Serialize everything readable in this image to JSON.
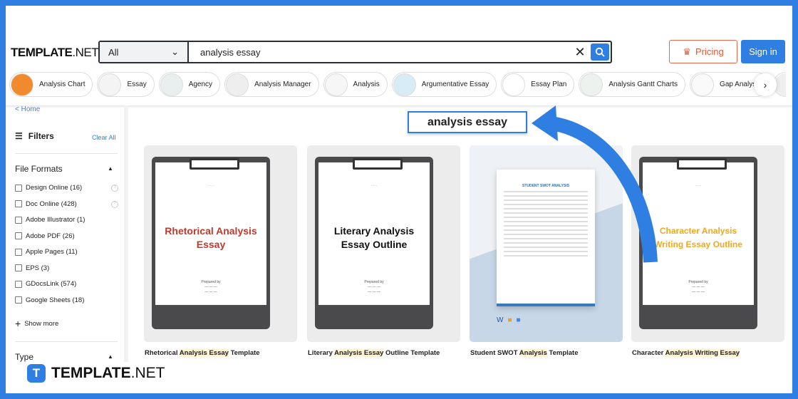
{
  "header": {
    "logo_bold": "TEMPLATE",
    "logo_light": ".NET",
    "category": "All",
    "query": "analysis essay",
    "pricing": "Pricing",
    "signin": "Sign in"
  },
  "chips": [
    "Analysis Chart",
    "Essay",
    "Agency",
    "Analysis Manager",
    "Analysis",
    "Argumentative Essay",
    "Essay Plan",
    "Analysis Gantt Charts",
    "Gap Analysis"
  ],
  "sidebar": {
    "home": "< Home",
    "filters": "Filters",
    "clear_all": "Clear All",
    "file_formats": "File Formats",
    "formats": [
      "Design Online (16)",
      "Doc Online (428)",
      "Adobe Illustrator (1)",
      "Adobe PDF (26)",
      "Apple Pages (11)",
      "EPS (3)",
      "GDocsLink (574)",
      "Google Sheets (18)"
    ],
    "show_more": "Show more",
    "type": "Type"
  },
  "callout": "analysis essay",
  "cards": [
    {
      "pre": "Rhetorical ",
      "hl": "Analysis Essay",
      "post": " Template",
      "doc_title": "Rhetorical Analysis Essay",
      "color": "#c0392b"
    },
    {
      "pre": "Literary ",
      "hl": "Analysis Essay",
      "post": " Outline Template",
      "doc_title": "Literary Analysis Essay Outline",
      "color": "#111111"
    },
    {
      "pre": "Student SWOT ",
      "hl": "Analysis",
      "post": " Template",
      "doc_title": "STUDENT SWOT ANALYSIS",
      "color": "#2f6fb0"
    },
    {
      "pre": "Character ",
      "hl": "Analysis Writing Essay",
      "post": "",
      "doc_title": "Character Analysis Writing Essay Outline",
      "color": "#f0a81c"
    }
  ],
  "footer": {
    "logo_bold": "TEMPLATE",
    "logo_light": ".NET"
  },
  "colors": {
    "brand": "#2f7fe2",
    "pricing": "#e05a3a"
  }
}
